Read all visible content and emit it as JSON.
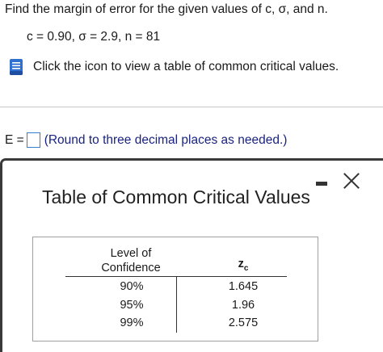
{
  "question": {
    "prompt": "Find the margin of error for the given values of c, σ, and n.",
    "given": "c = 0.90, σ = 2.9, n = 81",
    "info_text": "Click the icon to view a table of common critical values.",
    "answer_label": "E =",
    "answer_value": "",
    "hint": "(Round to three decimal places as needed.)"
  },
  "panel": {
    "title": "Table of Common Critical Values",
    "table": {
      "header_conf_line1": "Level of",
      "header_conf_line2": "Confidence",
      "header_z": "z",
      "header_z_sub": "c",
      "rows": [
        {
          "confidence": "90%",
          "z": "1.645"
        },
        {
          "confidence": "95%",
          "z": "1.96"
        },
        {
          "confidence": "99%",
          "z": "2.575"
        }
      ]
    }
  },
  "colors": {
    "icon_blue": "#2f6fd0",
    "answer_box_border": "#2f7fd8",
    "hint_text": "#1a237e"
  },
  "icons": {
    "info": "book-icon",
    "minimize": "minimize-icon",
    "close": "close-icon"
  }
}
